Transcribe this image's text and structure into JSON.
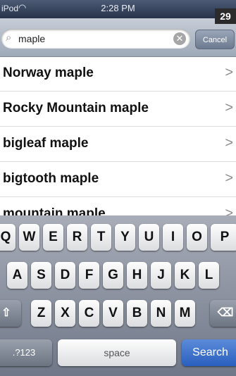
{
  "status_bar": {
    "carrier": "iPod",
    "wifi_icon": "wifi-icon",
    "time": "2:28 PM"
  },
  "badge": "29",
  "search": {
    "value": "maple",
    "placeholder": "",
    "cancel_label": "Cancel"
  },
  "results": [
    "Norway maple",
    "Rocky Mountain maple",
    "bigleaf maple",
    "bigtooth maple",
    "mountain maple"
  ],
  "chevron": ">",
  "keyboard": {
    "row1": [
      "Q",
      "W",
      "E",
      "R",
      "T",
      "Y",
      "U",
      "I",
      "O",
      "P"
    ],
    "row2": [
      "A",
      "S",
      "D",
      "F",
      "G",
      "H",
      "J",
      "K",
      "L"
    ],
    "row3": [
      "Z",
      "X",
      "C",
      "V",
      "B",
      "N",
      "M"
    ],
    "shift_icon": "shift-icon",
    "delete_icon": "backspace-icon",
    "numbers_label": ".?123",
    "space_label": "space",
    "search_label": "Search"
  }
}
